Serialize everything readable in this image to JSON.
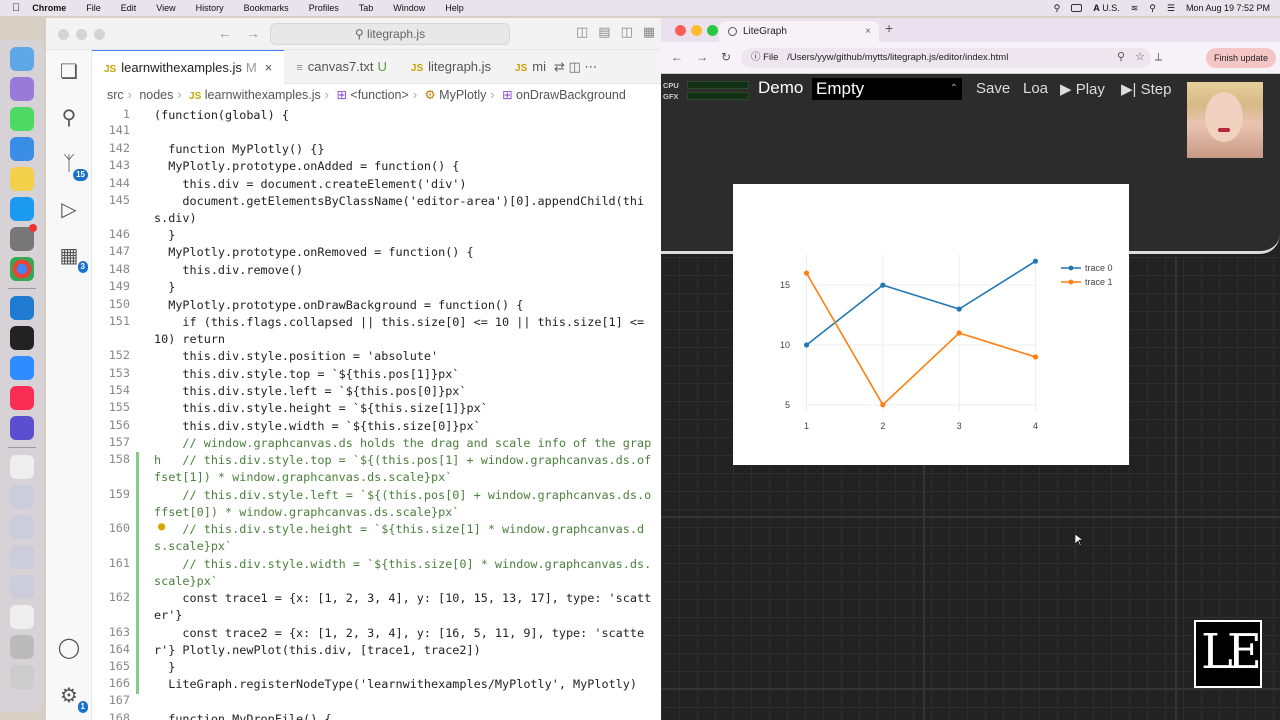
{
  "menubar": {
    "app": "Chrome",
    "items": [
      "File",
      "Edit",
      "View",
      "History",
      "Bookmarks",
      "Profiles",
      "Tab",
      "Window",
      "Help"
    ],
    "input_source": "U.S.",
    "clock": "Mon Aug 19  7:52 PM"
  },
  "dock": {
    "badges": [
      "1",
      "15",
      "3",
      "1"
    ]
  },
  "vscode": {
    "search": "litegraph.js",
    "tabs": [
      {
        "icon": "JS",
        "label": "learnwithexamples.js",
        "status": "M",
        "close": "×"
      },
      {
        "icon": "≡",
        "label": "canvas7.txt",
        "status": "U"
      },
      {
        "icon": "JS",
        "label": "litegraph.js"
      },
      {
        "icon": "JS",
        "label": "mi"
      }
    ],
    "breadcrumb": [
      "src",
      "nodes",
      "learnwithexamples.js",
      "<function>",
      "MyPlotly",
      "onDrawBackground"
    ],
    "activity_badges": {
      "scm": "15",
      "extensions": "3",
      "settings": "1"
    },
    "lines": [
      {
        "n": "1",
        "t": "(function(global) {"
      },
      {
        "n": "141",
        "t": ""
      },
      {
        "n": "142",
        "t": "  function MyPlotly() {}"
      },
      {
        "n": "143",
        "t": "  MyPlotly.prototype.onAdded = function() {"
      },
      {
        "n": "144",
        "t": "    this.div = document.createElement('div')"
      },
      {
        "n": "145",
        "t": "    document.getElementsByClassName('editor-area')[0].appendChild(this.div)"
      },
      {
        "n": "146",
        "t": "  }"
      },
      {
        "n": "147",
        "t": "  MyPlotly.prototype.onRemoved = function() {"
      },
      {
        "n": "148",
        "t": "    this.div.remove()"
      },
      {
        "n": "149",
        "t": "  }"
      },
      {
        "n": "150",
        "t": "  MyPlotly.prototype.onDrawBackground = function() {"
      },
      {
        "n": "151",
        "t": "    if (this.flags.collapsed || this.size[0] <= 10 || this.size[1] <= 10) return"
      },
      {
        "n": "152",
        "t": "    this.div.style.position = 'absolute'"
      },
      {
        "n": "153",
        "t": "    this.div.style.top = `${this.pos[1]}px`"
      },
      {
        "n": "154",
        "t": "    this.div.style.left = `${this.pos[0]}px`"
      },
      {
        "n": "155",
        "t": "    this.div.style.height = `${this.size[1]}px`"
      },
      {
        "n": "156",
        "t": "    this.div.style.width = `${this.size[0]}px`"
      },
      {
        "n": "157",
        "t": "    // window.graphcanvas.ds holds the drag and scale info of the graph"
      },
      {
        "n": "158",
        "t": "    // this.div.style.top = `${(this.pos[1] + window.graphcanvas.ds.offset[1]) * window.graphcanvas.ds.scale}px`"
      },
      {
        "n": "159",
        "t": "    // this.div.style.left = `${(this.pos[0] + window.graphcanvas.ds.offset[0]) * window.graphcanvas.ds.scale}px`"
      },
      {
        "n": "160",
        "t": "    // this.div.style.height = `${this.size[1] * window.graphcanvas.ds.scale}px`"
      },
      {
        "n": "161",
        "t": "    // this.div.style.width = `${this.size[0] * window.graphcanvas.ds.scale}px`"
      },
      {
        "n": "162",
        "t": "    const trace1 = {x: [1, 2, 3, 4], y: [10, 15, 13, 17], type: 'scatter'}"
      },
      {
        "n": "163",
        "t": "    const trace2 = {x: [1, 2, 3, 4], y: [16, 5, 11, 9], type: 'scatter'}"
      },
      {
        "n": "164",
        "t": "    Plotly.newPlot(this.div, [trace1, trace2])"
      },
      {
        "n": "165",
        "t": "  }"
      },
      {
        "n": "166",
        "t": "  LiteGraph.registerNodeType('learnwithexamples/MyPlotly', MyPlotly)"
      },
      {
        "n": "167",
        "t": ""
      },
      {
        "n": "168",
        "t": "  function MyDropFile() {"
      }
    ]
  },
  "browser": {
    "tab_title": "LiteGraph",
    "url_scheme": "File",
    "url": "/Users/yyw/github/mytts/litegraph.js/editor/index.html",
    "update_button": "Finish update"
  },
  "litegraph": {
    "meters": [
      "CPU",
      "GFX"
    ],
    "demo_label": "Demo",
    "demo_selected": "Empty",
    "buttons": {
      "save": "Save",
      "load": "Loa",
      "play": "Play",
      "step": "Step"
    },
    "logo": "LE"
  },
  "chart_data": {
    "type": "line",
    "x": [
      1,
      2,
      3,
      4
    ],
    "series": [
      {
        "name": "trace 0",
        "values": [
          10,
          15,
          13,
          17
        ],
        "color": "#1f77b4"
      },
      {
        "name": "trace 1",
        "values": [
          16,
          5,
          11,
          9
        ],
        "color": "#ff7f0e"
      }
    ],
    "xticks": [
      "1",
      "2",
      "3",
      "4"
    ],
    "yticks": [
      "5",
      "10",
      "15"
    ],
    "xlim": [
      0.98,
      4.02
    ],
    "ylim": [
      4.4,
      17.6
    ],
    "legend": "top-right"
  }
}
